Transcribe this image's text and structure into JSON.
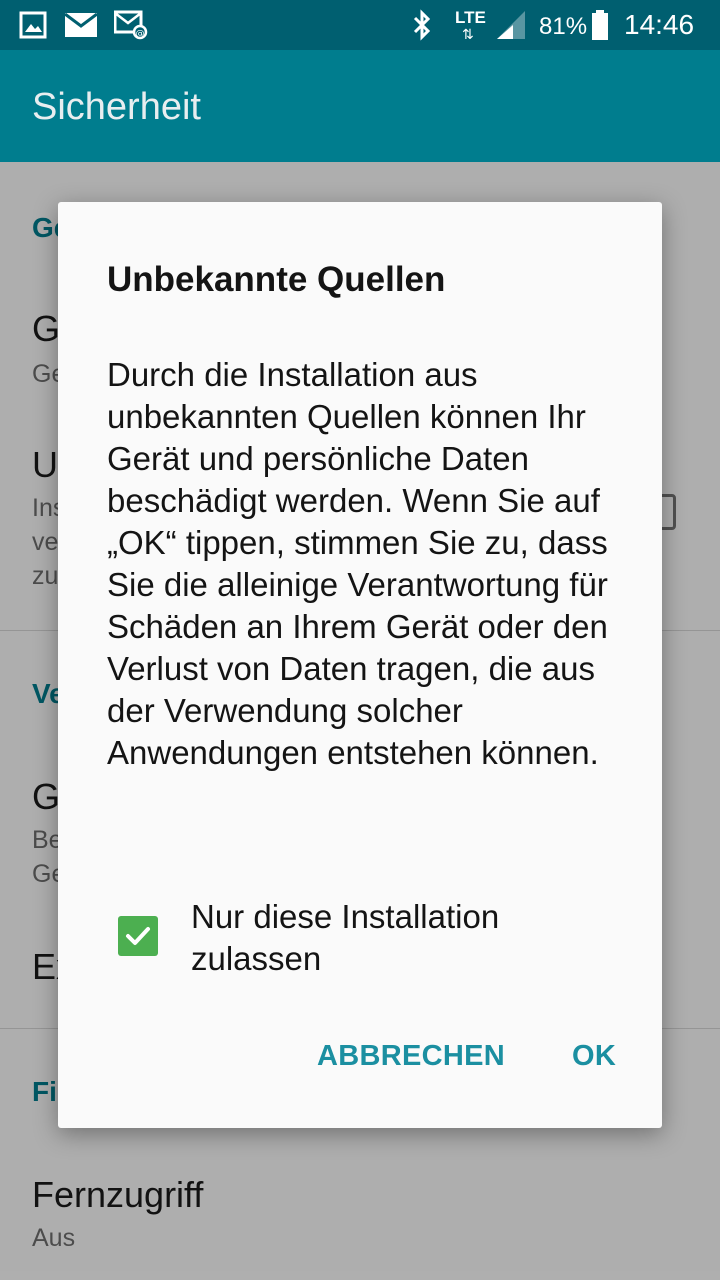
{
  "status_bar": {
    "icons": [
      "image-icon",
      "email-icon",
      "email-sync-icon",
      "bluetooth-icon",
      "signal-icon",
      "battery-icon"
    ],
    "network": "LTE",
    "battery": "81%",
    "time": "14:46"
  },
  "app_bar": {
    "title": "Sicherheit"
  },
  "background": {
    "category1": "Ge",
    "item1_title": "G",
    "item1_sub": "Ge",
    "item2_title": "U",
    "item2_sub1": "Ins",
    "item2_sub2": "ve",
    "item2_sub3": "zu",
    "category2": "Ve",
    "item3_title": "G",
    "item3_sub1": "Be",
    "item3_sub2": "Ge",
    "item4_title": "Ex",
    "category3": "Fi",
    "item5_title": "Fernzugriff",
    "item5_sub": "Aus"
  },
  "dialog": {
    "title": "Unbekannte Quellen",
    "message": "Durch die Installation aus unbekannten Quellen können Ihr Gerät und persönliche Daten beschädigt werden. Wenn Sie auf „OK“ tippen, stimmen Sie zu, dass Sie die alleinige Verantwortung für Schäden an Ihrem Gerät oder den Verlust von Daten tragen, die aus der Verwendung solcher Anwendungen entstehen können.",
    "checkbox_label": "Nur diese Installation zulassen",
    "checkbox_checked": true,
    "cancel_label": "ABBRECHEN",
    "ok_label": "OK"
  },
  "colors": {
    "status_bar": "#005f70",
    "app_bar": "#007d8e",
    "accent": "#1b8fa1",
    "checkbox": "#4caf50"
  }
}
